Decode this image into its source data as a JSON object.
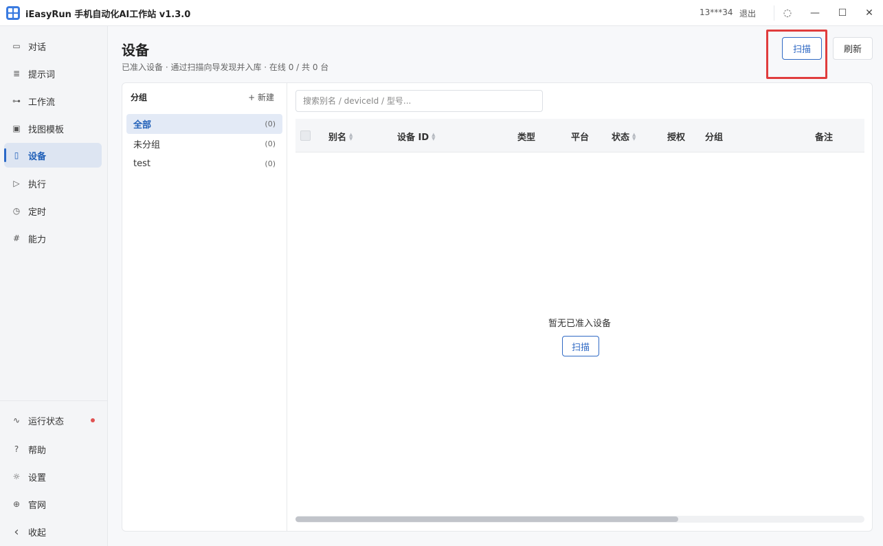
{
  "window": {
    "title": "iEasyRun 手机自动化AI工作站 v1.3.0",
    "user": "13***34",
    "logout": "退出",
    "controls": {
      "loading": "◌",
      "minimize": "—",
      "maximize": "☐",
      "close": "✕"
    }
  },
  "sidebar": {
    "items": [
      {
        "label": "对话",
        "icon": "chat-icon",
        "glyph": "▭"
      },
      {
        "label": "提示词",
        "icon": "document-icon",
        "glyph": "≣"
      },
      {
        "label": "工作流",
        "icon": "workflow-icon",
        "glyph": "⊶"
      },
      {
        "label": "找图模板",
        "icon": "image-icon",
        "glyph": "▣"
      },
      {
        "label": "设备",
        "icon": "phone-icon",
        "glyph": "▯"
      },
      {
        "label": "执行",
        "icon": "play-icon",
        "glyph": "▷"
      },
      {
        "label": "定时",
        "icon": "clock-icon",
        "glyph": "◷"
      },
      {
        "label": "能力",
        "icon": "hash-icon",
        "glyph": "#"
      }
    ],
    "active_index": 4,
    "bottom": [
      {
        "label": "运行状态",
        "icon": "pulse-icon",
        "glyph": "∿"
      },
      {
        "label": "帮助",
        "icon": "help-icon",
        "glyph": "?"
      },
      {
        "label": "设置",
        "icon": "gear-icon",
        "glyph": "☼"
      },
      {
        "label": "官网",
        "icon": "globe-icon",
        "glyph": "⊕"
      },
      {
        "label": "收起",
        "icon": "chevron-left-icon",
        "glyph": "‹"
      }
    ]
  },
  "page": {
    "title": "设备",
    "subtitle": "已准入设备 · 通过扫描向导发现并入库 · 在线 0 / 共 0 台",
    "scan_button": "扫描",
    "refresh_button": "刷新"
  },
  "groups": {
    "header": "分组",
    "new_label": "+ 新建",
    "items": [
      {
        "name": "全部",
        "count": "(0)"
      },
      {
        "name": "未分组",
        "count": "(0)"
      },
      {
        "name": "test",
        "count": "(0)"
      }
    ]
  },
  "search": {
    "placeholder": "搜索别名 / deviceId / 型号..."
  },
  "table": {
    "columns": [
      "别名",
      "设备 ID",
      "类型",
      "平台",
      "状态",
      "授权",
      "分组",
      "备注"
    ],
    "rows": [],
    "empty_text": "暂无已准入设备",
    "empty_scan_button": "扫描"
  },
  "colors": {
    "accent": "#2f69c4",
    "highlight": "#e03c3c",
    "status_dot": "#e05252"
  }
}
